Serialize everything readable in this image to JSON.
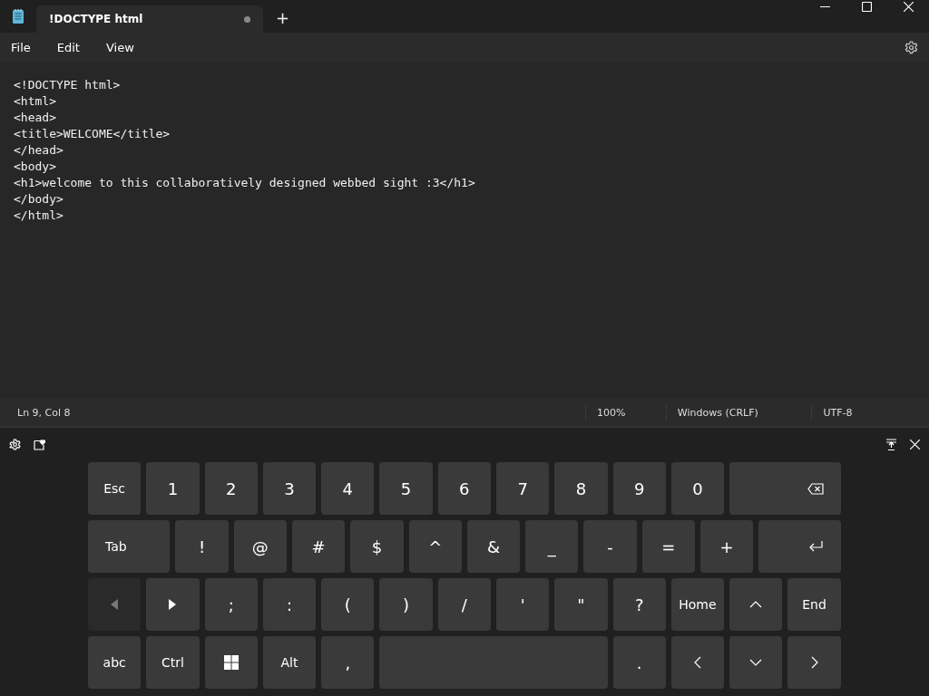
{
  "tab": {
    "title": "!DOCTYPE html",
    "modified": true,
    "new_tab": "+"
  },
  "menu": [
    "File",
    "Edit",
    "View"
  ],
  "editor_lines": [
    "<!DOCTYPE html>",
    "<html>",
    "<head>",
    "<title>WELCOME</title>",
    "</head>",
    "<body>",
    "<h1>welcome to this collaboratively designed webbed sight :3</h1>",
    "</body>",
    "</html>"
  ],
  "status_bar": [
    "Ln 9, Col 8",
    "100%",
    "Windows (CRLF)",
    "UTF-8"
  ],
  "keyboard_rows": [
    [
      {
        "kind": "key",
        "label": "Esc",
        "disabled": false
      },
      {
        "kind": "key",
        "label": "1",
        "disabled": false
      },
      {
        "kind": "key",
        "label": "2",
        "disabled": false
      },
      {
        "kind": "key",
        "label": "3",
        "disabled": false
      },
      {
        "kind": "key",
        "label": "4",
        "disabled": false
      },
      {
        "kind": "key",
        "label": "5",
        "disabled": false
      },
      {
        "kind": "key",
        "label": "6",
        "disabled": false
      },
      {
        "kind": "key",
        "label": "7",
        "disabled": false
      },
      {
        "kind": "key",
        "label": "8",
        "disabled": false
      },
      {
        "kind": "key",
        "label": "9",
        "disabled": false
      },
      {
        "kind": "key",
        "label": "0",
        "disabled": false
      },
      {
        "kind": "backspace",
        "disabled": false
      }
    ],
    [
      {
        "kind": "tab",
        "label": "Tab",
        "disabled": false
      },
      {
        "kind": "key",
        "label": "!",
        "disabled": false
      },
      {
        "kind": "key",
        "label": "@",
        "disabled": false
      },
      {
        "kind": "key",
        "label": "#",
        "disabled": false
      },
      {
        "kind": "key",
        "label": "$",
        "disabled": false
      },
      {
        "kind": "key",
        "label": "^",
        "disabled": false
      },
      {
        "kind": "key",
        "label": "&",
        "disabled": false
      },
      {
        "kind": "key",
        "label": "_",
        "disabled": false
      },
      {
        "kind": "key",
        "label": "-",
        "disabled": false
      },
      {
        "kind": "key",
        "label": "=",
        "disabled": false
      },
      {
        "kind": "key",
        "label": "+",
        "disabled": false
      },
      {
        "kind": "enter",
        "disabled": false
      }
    ],
    [
      {
        "kind": "prev",
        "disabled": true
      },
      {
        "kind": "next",
        "disabled": false
      },
      {
        "kind": "key",
        "label": ";",
        "disabled": false
      },
      {
        "kind": "key",
        "label": ":",
        "disabled": false
      },
      {
        "kind": "key",
        "label": "(",
        "disabled": false
      },
      {
        "kind": "key",
        "label": ")",
        "disabled": false
      },
      {
        "kind": "key",
        "label": "/",
        "disabled": false
      },
      {
        "kind": "key",
        "label": "'",
        "disabled": false
      },
      {
        "kind": "key",
        "label": "\"",
        "disabled": false
      },
      {
        "kind": "key",
        "label": "?",
        "disabled": false
      },
      {
        "kind": "key",
        "label": "Home",
        "disabled": false
      },
      {
        "kind": "up",
        "disabled": false
      },
      {
        "kind": "key",
        "label": "End",
        "disabled": false
      }
    ],
    [
      {
        "kind": "key",
        "label": "abc",
        "disabled": false
      },
      {
        "kind": "key",
        "label": "Ctrl",
        "disabled": false
      },
      {
        "kind": "windows",
        "disabled": false
      },
      {
        "kind": "key",
        "label": "Alt",
        "disabled": false
      },
      {
        "kind": "key",
        "label": ",",
        "disabled": false
      },
      {
        "kind": "space",
        "disabled": false
      },
      {
        "kind": "key",
        "label": ".",
        "disabled": false
      },
      {
        "kind": "left",
        "disabled": false
      },
      {
        "kind": "down",
        "disabled": false
      },
      {
        "kind": "right",
        "disabled": false
      }
    ]
  ]
}
